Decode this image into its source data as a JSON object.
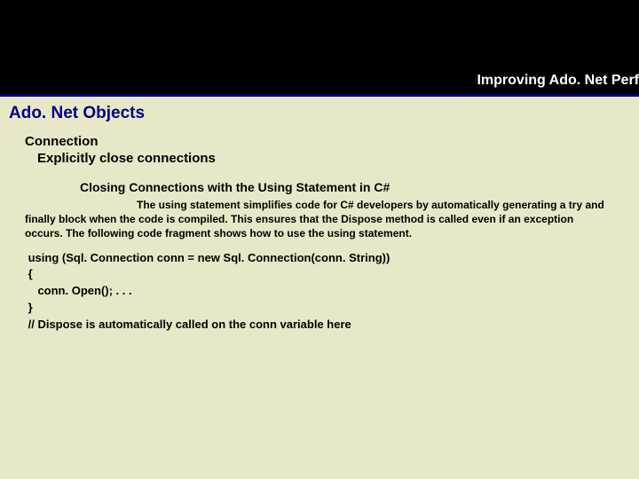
{
  "header": {
    "title": "Improving Ado. Net Perf"
  },
  "slide": {
    "title": "Ado. Net Objects",
    "sub1": "Connection",
    "sub2": "Explicitly close connections",
    "sub3": "Closing Connections with the Using Statement in C#",
    "body": "The using statement simplifies code for C# developers by automatically generating a try and finally block when the code is compiled. This ensures that the Dispose method is called even if an exception occurs. The following code fragment shows how to use the using statement.",
    "code": " using (Sql. Connection conn = new Sql. Connection(conn. String))\n {\n    conn. Open(); . . .\n }\n // Dispose is automatically called on the conn variable here"
  }
}
